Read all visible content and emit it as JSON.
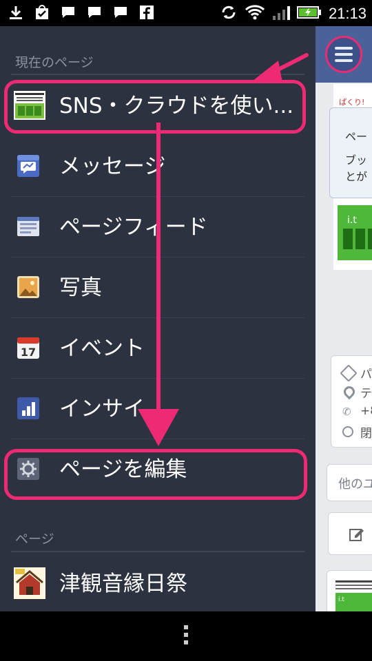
{
  "status_bar": {
    "time": "21:13"
  },
  "drawer": {
    "current_section_header": "現在のページ",
    "current_page": {
      "label": "SNS・クラウドを使い...",
      "icon": "page-thumbnail"
    },
    "menu_items": [
      {
        "label": "メッセージ",
        "icon": "messages-icon"
      },
      {
        "label": "ページフィード",
        "icon": "page-feed-icon"
      },
      {
        "label": "写真",
        "icon": "photos-icon"
      },
      {
        "label": "イベント",
        "icon": "events-icon"
      },
      {
        "label": "インサイ",
        "icon": "insights-icon"
      },
      {
        "label": "ページを編集",
        "icon": "gear-icon"
      }
    ],
    "pages_section_header": "ページ",
    "pages": [
      {
        "label": "津観音縁日祭",
        "icon": "page-thumbnail"
      }
    ]
  },
  "right_pane": {
    "tooltip_line1": "ペー",
    "tooltip_line2": "ブッ",
    "tooltip_line3": "とが",
    "info_rows": [
      "パ",
      "テ",
      "+8",
      "閉"
    ],
    "other_button": "他のユ"
  },
  "colors": {
    "highlight": "#ee2a74",
    "drawer_bg": "#2c3240",
    "nav_blue": "#4b6298"
  }
}
